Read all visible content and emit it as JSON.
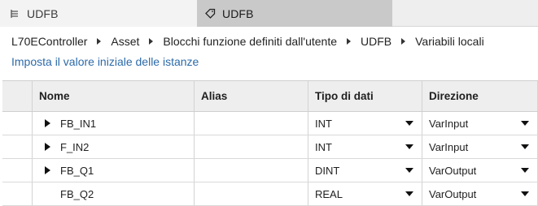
{
  "tabs": [
    {
      "label": "UDFB",
      "icon": "list-icon",
      "active": false
    },
    {
      "label": "UDFB",
      "icon": "tag-icon",
      "active": true
    }
  ],
  "breadcrumb": [
    "L70EController",
    "Asset",
    "Blocchi funzione definiti dall'utente",
    "UDFB",
    "Variabili locali"
  ],
  "action_link": "Imposta il valore iniziale delle istanze",
  "table": {
    "headers": [
      "Nome",
      "Alias",
      "Tipo di dati",
      "Direzione"
    ],
    "rows": [
      {
        "name": "FB_IN1",
        "alias": "",
        "type": "INT",
        "direction": "VarInput",
        "expandable": true
      },
      {
        "name": "F_IN2",
        "alias": "",
        "type": "INT",
        "direction": "VarInput",
        "expandable": true
      },
      {
        "name": "FB_Q1",
        "alias": "",
        "type": "DINT",
        "direction": "VarOutput",
        "expandable": true
      },
      {
        "name": "FB_Q2",
        "alias": "",
        "type": "REAL",
        "direction": "VarOutput",
        "expandable": false
      }
    ]
  }
}
